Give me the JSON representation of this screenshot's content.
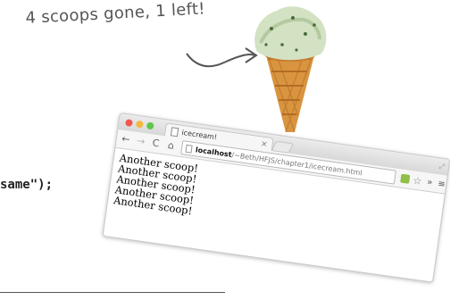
{
  "annotation": "4 scoops gone, 1 left!",
  "code_fragment": "same\");",
  "browser": {
    "tab": {
      "title": "icecream!",
      "close": "×"
    },
    "toolbar": {
      "back": "←",
      "forward": "→",
      "reload": "C",
      "home": "⌂",
      "url_host": "localhost",
      "url_path": "/~Beth/HFJS/chapter1/icecream.html",
      "overflow": "»",
      "menu": "≡"
    },
    "content_lines": [
      "Another scoop!",
      "Another scoop!",
      "Another scoop!",
      "Another scoop!",
      "Another scoop!"
    ]
  },
  "icons": [
    "arrow-icon",
    "ice-cream-cone-icon",
    "star-icon",
    "extension-icon"
  ]
}
